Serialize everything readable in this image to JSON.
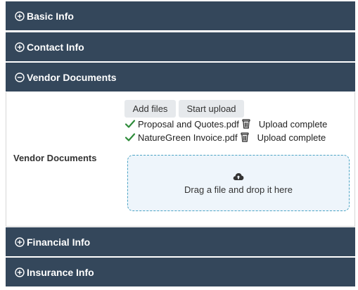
{
  "sections": {
    "basic": {
      "label": "Basic Info",
      "icon": "plus-circle-icon"
    },
    "contact": {
      "label": "Contact Info",
      "icon": "plus-circle-icon"
    },
    "vendor": {
      "label": "Vendor Documents",
      "icon": "minus-circle-icon"
    },
    "financial": {
      "label": "Financial Info",
      "icon": "plus-circle-icon"
    },
    "insurance": {
      "label": "Insurance Info",
      "icon": "plus-circle-icon"
    }
  },
  "vendor_documents": {
    "field_label": "Vendor Documents",
    "add_files_label": "Add files",
    "start_upload_label": "Start upload",
    "files": [
      {
        "name": "Proposal and Quotes.pdf",
        "status": "Upload complete"
      },
      {
        "name": "NatureGreen Invoice.pdf",
        "status": "Upload complete"
      }
    ],
    "dropzone_text": "Drag a file and drop it here",
    "dropzone_icon": "cloud-upload-icon"
  },
  "colors": {
    "header_bg": "#34475b",
    "check_green": "#2e8b3a",
    "dropzone_border": "#4aa3c4",
    "dropzone_bg": "#eef5fb"
  }
}
